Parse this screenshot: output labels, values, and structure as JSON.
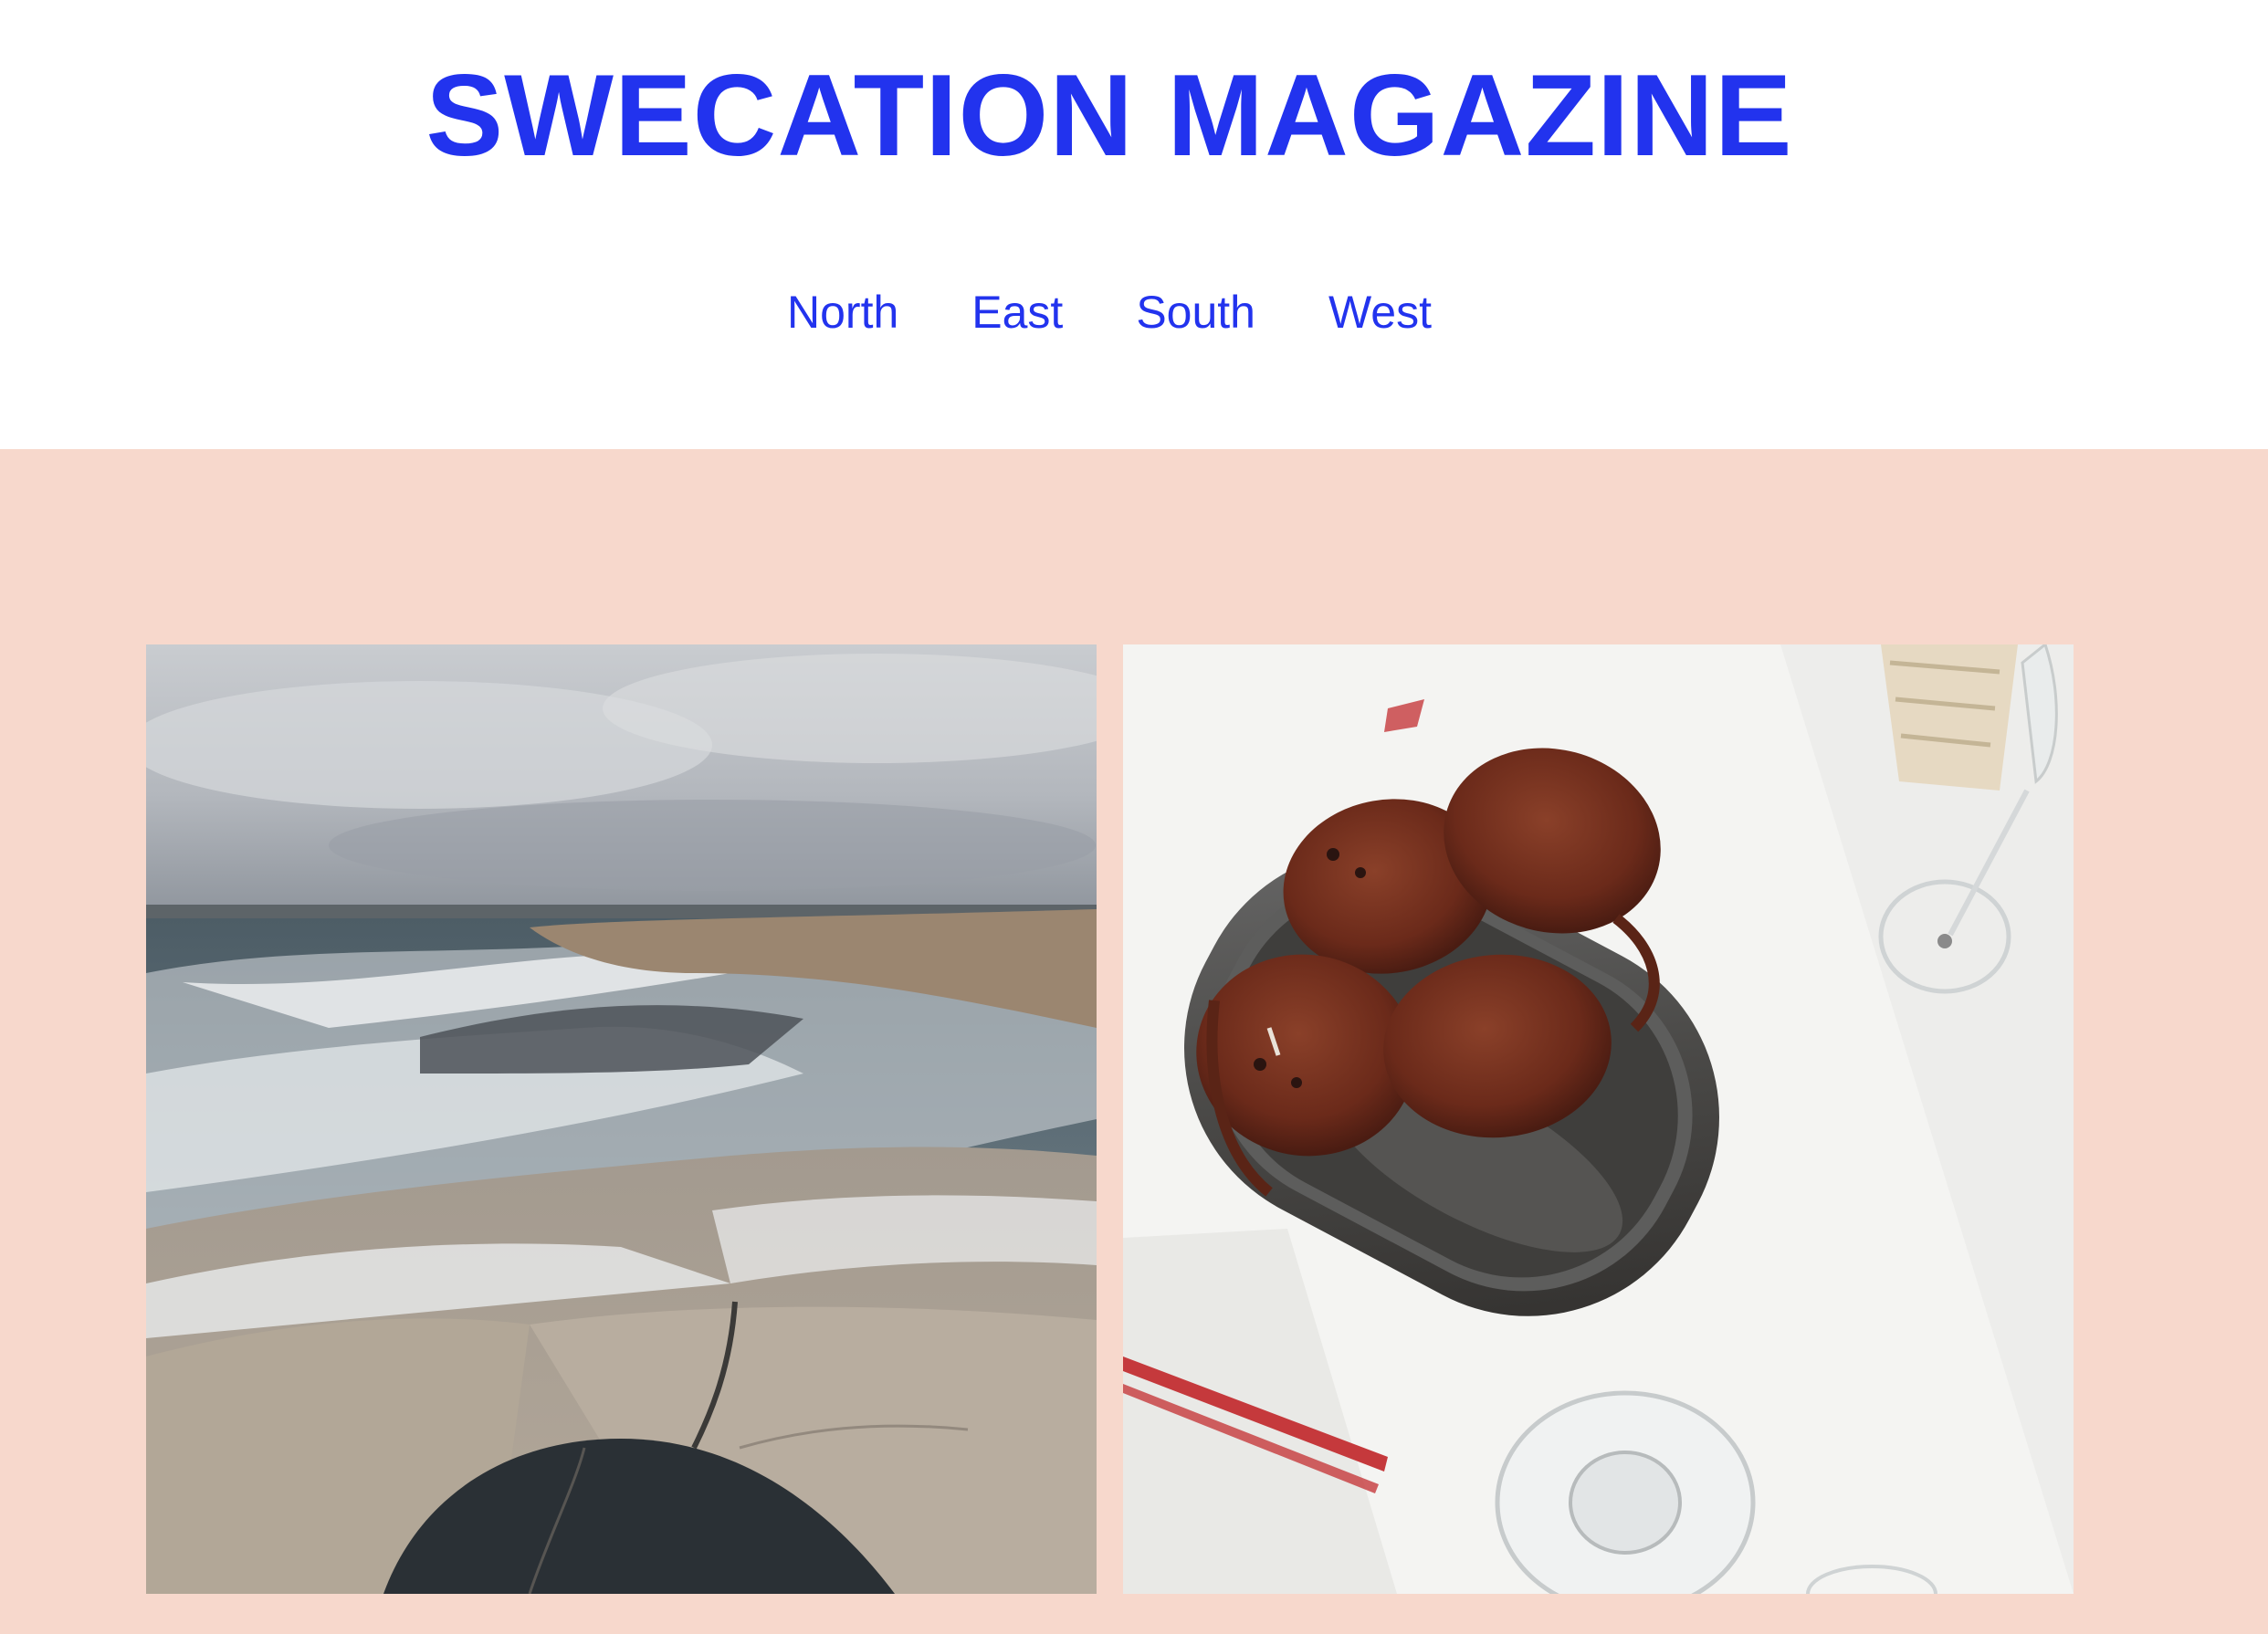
{
  "site": {
    "title": "SWECATION MAGAZINE"
  },
  "nav": {
    "items": [
      {
        "label": "North"
      },
      {
        "label": "East"
      },
      {
        "label": "South"
      },
      {
        "label": "West"
      }
    ]
  },
  "colors": {
    "brand_blue": "#2233ee",
    "hero_background": "#f7d8cc",
    "page_background": "#ffffff"
  },
  "hero": {
    "images": [
      {
        "name": "rocky-coast-photo"
      },
      {
        "name": "crabs-platter-photo"
      }
    ]
  }
}
